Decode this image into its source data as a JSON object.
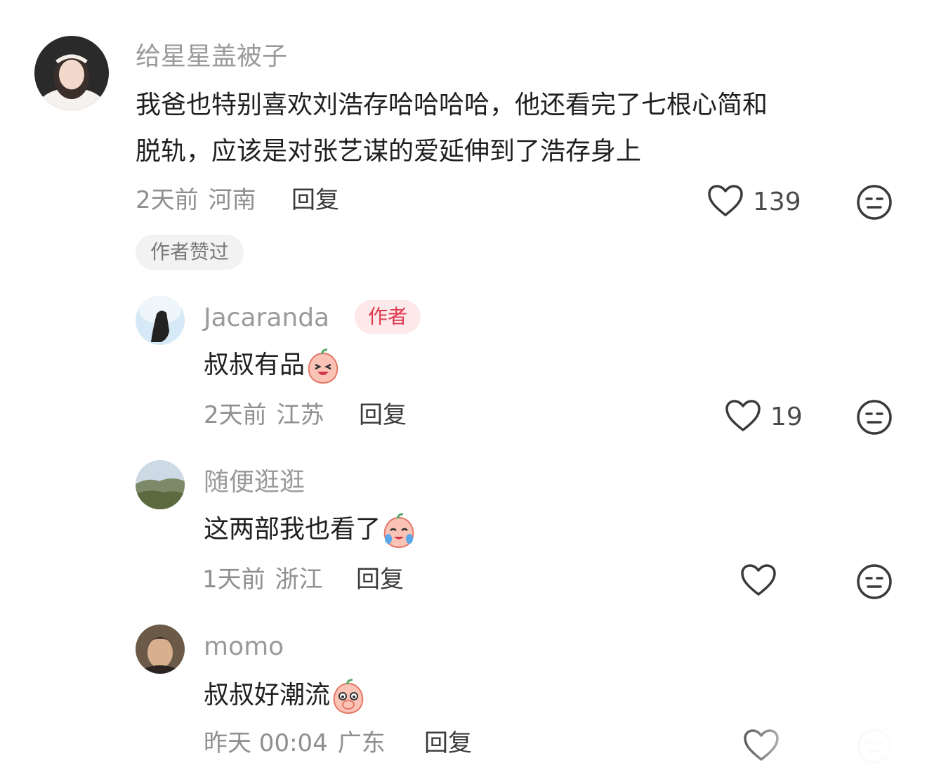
{
  "comments": [
    {
      "username": "给星星盖被子",
      "text_line1": "我爸也特别喜欢刘浩存哈哈哈哈，他还看完了七根心简和",
      "text_line2": "脱轨，应该是对张艺谋的爱延伸到了浩存身上",
      "time": "2天前",
      "location": "河南",
      "reply_label": "回复",
      "like_count": "139",
      "tag": "作者赞过"
    },
    {
      "username": "Jacaranda",
      "badge": "作者",
      "text": "叔叔有品",
      "emoji_icon": "laughing-peach-emoji",
      "time": "2天前",
      "location": "江苏",
      "reply_label": "回复",
      "like_count": "19"
    },
    {
      "username": "随便逛逛",
      "text": "这两部我也看了",
      "emoji_icon": "crying-peach-emoji",
      "time": "1天前",
      "location": "浙江",
      "reply_label": "回复",
      "like_count": ""
    },
    {
      "username": "momo",
      "text": "叔叔好潮流",
      "emoji_icon": "smirking-peach-emoji",
      "time": "昨天 00:04",
      "location": "广东",
      "reply_label": "回复",
      "like_count": ""
    }
  ],
  "icons": {
    "like": "heart-outline-icon",
    "dislike": "meh-face-icon"
  },
  "colors": {
    "username": "#9a9a9a",
    "author_badge_bg": "#fde8ea",
    "author_badge_text": "#e0394f",
    "tag_bg": "#f2f2f2"
  }
}
